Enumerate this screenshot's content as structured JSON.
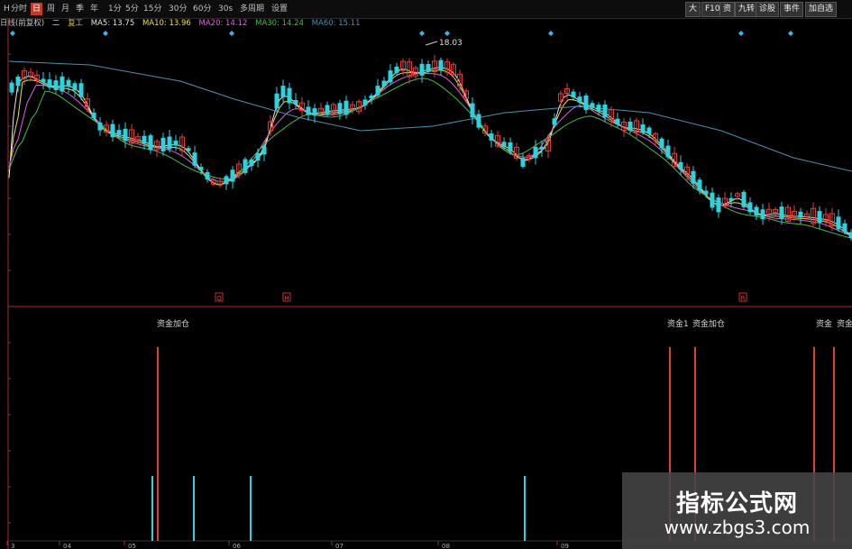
{
  "toolbar": {
    "items": [
      "H",
      "分时",
      "日",
      "周",
      "月",
      "季",
      "年",
      "1分",
      "5分",
      "15分",
      "30分",
      "60分",
      "30s",
      "多周期",
      "设置"
    ],
    "active_index": 2,
    "right_items": [
      "大",
      "F10",
      "资",
      "九转",
      "诊股",
      "事件",
      "加自选"
    ]
  },
  "legend": {
    "prefix": "日线(前复权)",
    "sub": "二",
    "name": "复工",
    "ma5": "MA5: 13.75",
    "ma10": "MA10: 13.96",
    "ma20": "MA20: 14.12",
    "ma30": "MA30: 14.24",
    "ma60": "MA60: 15.11"
  },
  "colors": {
    "up": "#e03c3c",
    "down": "#2bd3e0",
    "ma5": "#e8e8e8",
    "ma10": "#f0e040",
    "ma20": "#e060e0",
    "ma30": "#40c040",
    "ma60": "#4a90b0",
    "axis": "#a03030"
  },
  "chart_data": {
    "type": "candlestick",
    "price_high_label": "18.03",
    "signal_labels": [
      "资金加仓",
      "资金1",
      "资金加仓",
      "资金",
      "资金"
    ],
    "x_tick_labels": [
      "3",
      "04",
      "05",
      "06",
      "07",
      "08",
      "09"
    ],
    "marker_labels": [
      "Q",
      "H",
      "R"
    ]
  },
  "watermark": {
    "title": "指标公式网",
    "url": "www.zbgs3.com"
  }
}
